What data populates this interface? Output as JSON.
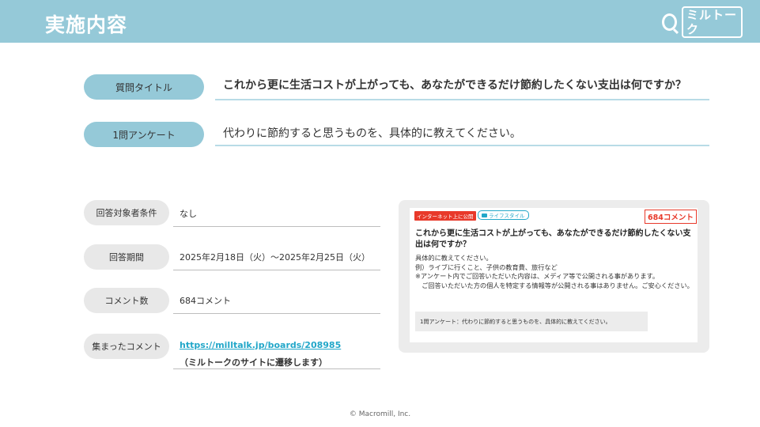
{
  "header": {
    "title": "実施内容",
    "logo_text": "ミルトーク"
  },
  "question_title": {
    "label": "質問タイトル",
    "text": "これから更に生活コストが上がっても、あなたができるだけ節約したくない支出は何ですか？"
  },
  "one_question": {
    "label": "1問アンケート",
    "text": "代わりに節約すると思うものを、具体的に教えてください。"
  },
  "info": {
    "condition": {
      "label": "回答対象者条件",
      "value": "なし"
    },
    "period": {
      "label": "回答期間",
      "value": "2025年2月18日（火）～2025年2月25日（火）"
    },
    "comment_count": {
      "label": "コメント数",
      "value": "684コメント"
    },
    "collected": {
      "label": "集まったコメント",
      "link": "https://milltalk.jp/boards/208985",
      "note": "（ミルトークのサイトに遷移します）"
    }
  },
  "preview": {
    "tag_public": "インターネット上に公開",
    "tag_category": "ライフスタイル",
    "count_badge": "684コメント",
    "title": "これから更に生活コストが上がっても、あなたができるだけ節約したくない支出は何ですか？",
    "body_lines": [
      "具体的に教えてください。",
      "例）ライブに行くこと、子供の教育費、旅行など",
      "※アンケート内でご回答いただいた内容は、メディア等で公開される事があります。",
      "　ご回答いただいた方の個人を特定する情報等が公開される事はありません。ご安心ください。"
    ],
    "note": "1問アンケート：代わりに節約すると思うものを、具体的に教えてください。"
  },
  "footer": {
    "copyright": "© Macromill, Inc."
  },
  "colors": {
    "header_bg": "#95c9d8",
    "accent_red": "#e8392a",
    "link_blue": "#22a7c9"
  }
}
